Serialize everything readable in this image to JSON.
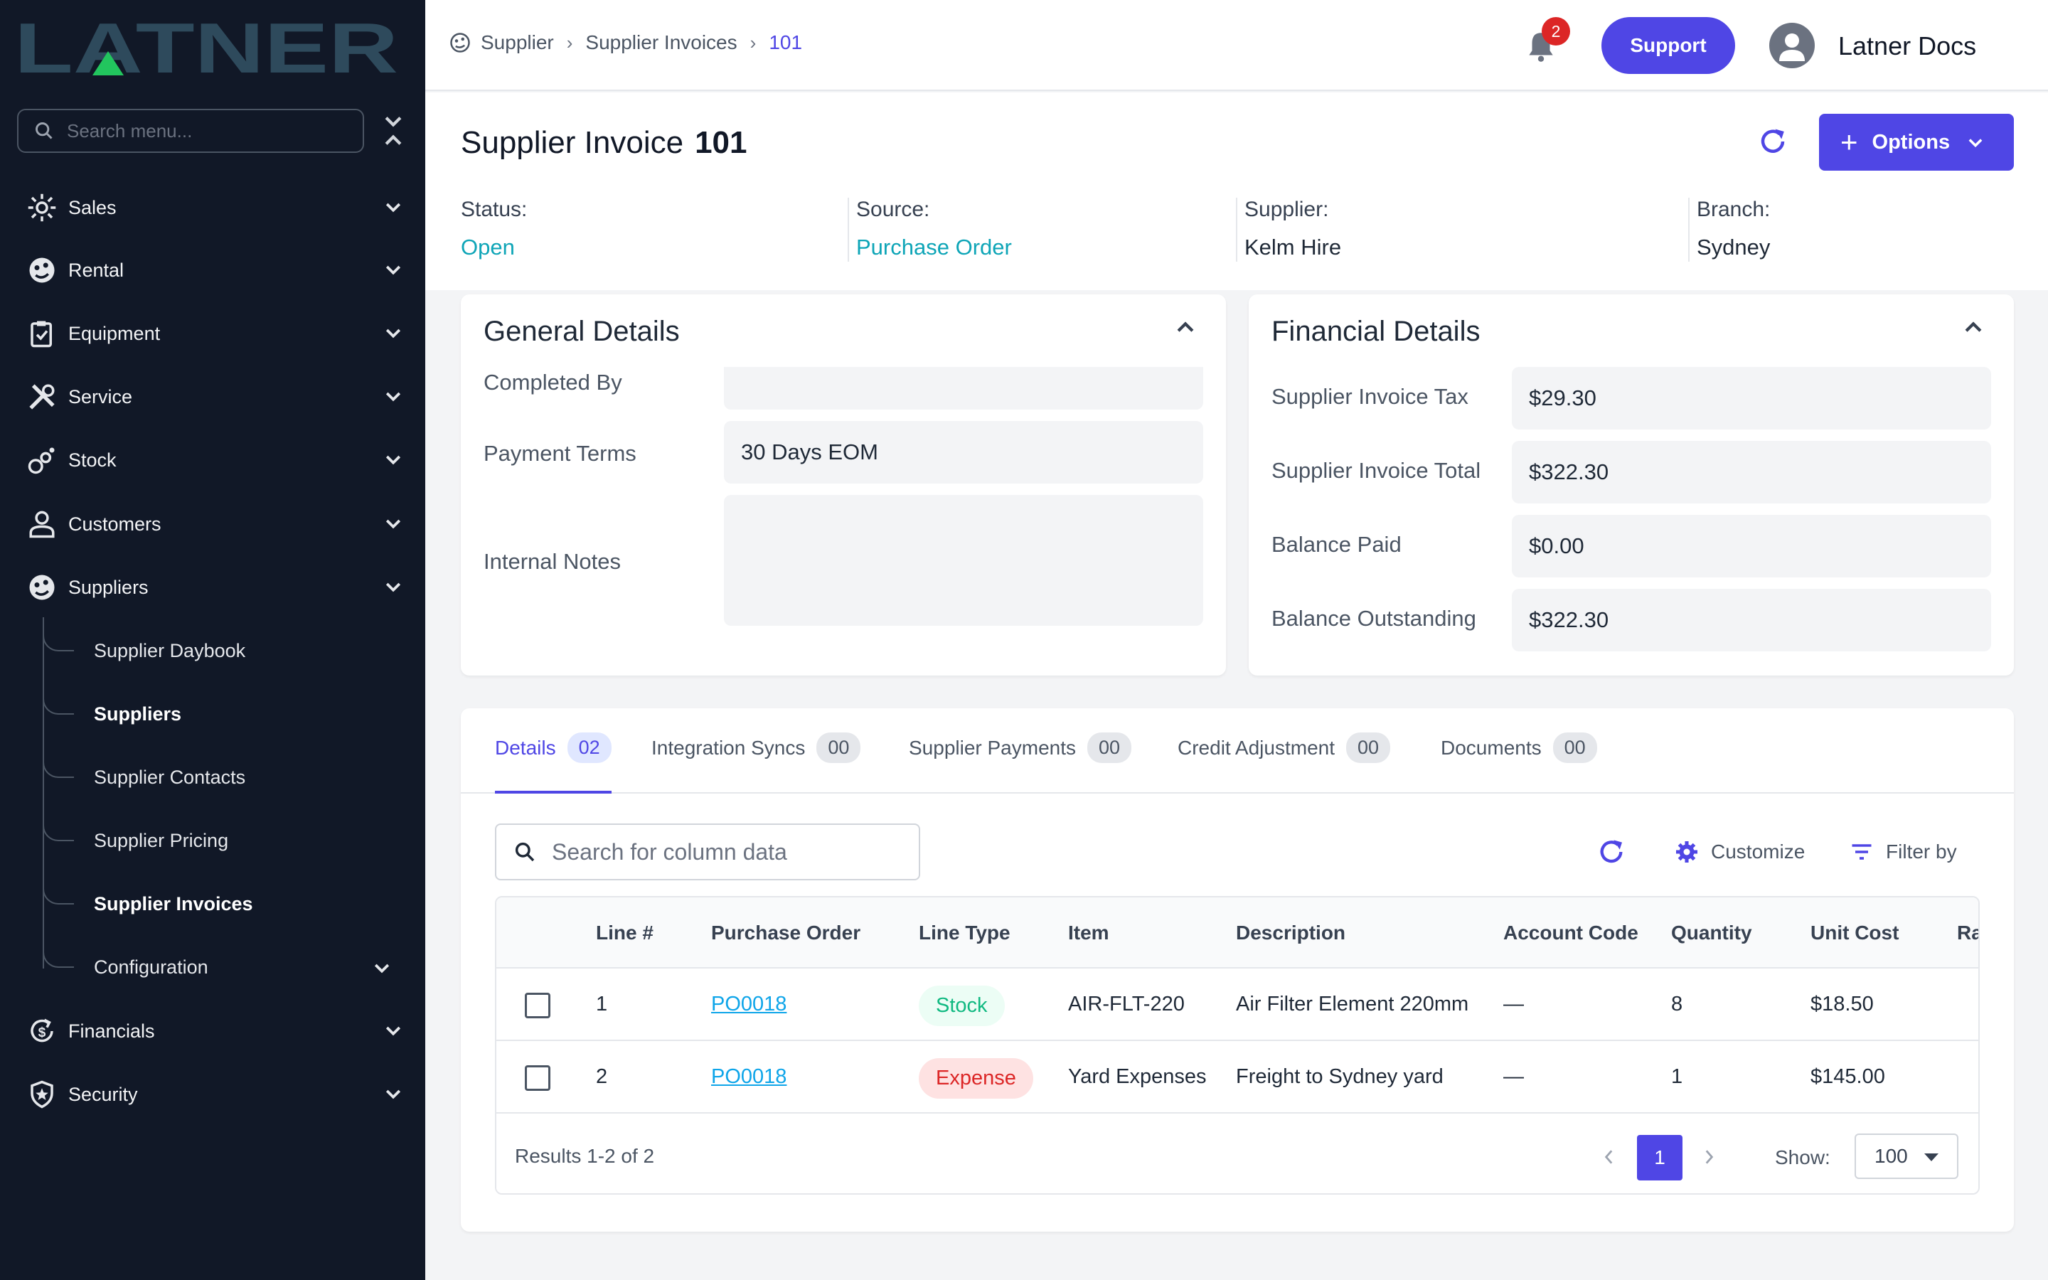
{
  "brand": {
    "logo_text": "LATNER",
    "accent": "#4f46e5",
    "logo_color": "#2e4a5c",
    "logo_accent": "#22c55e"
  },
  "sidebar": {
    "search_placeholder": "Search menu...",
    "items": [
      {
        "label": "Sales",
        "icon": "sales-icon"
      },
      {
        "label": "Rental",
        "icon": "rental-icon"
      },
      {
        "label": "Equipment",
        "icon": "equipment-icon"
      },
      {
        "label": "Service",
        "icon": "service-icon"
      },
      {
        "label": "Stock",
        "icon": "stock-icon"
      },
      {
        "label": "Customers",
        "icon": "customers-icon"
      },
      {
        "label": "Suppliers",
        "icon": "suppliers-icon"
      },
      {
        "label": "Financials",
        "icon": "financials-icon"
      },
      {
        "label": "Security",
        "icon": "security-icon"
      }
    ],
    "supplier_sub": [
      {
        "label": "Supplier Daybook"
      },
      {
        "label": "Suppliers"
      },
      {
        "label": "Supplier Contacts"
      },
      {
        "label": "Supplier Pricing"
      },
      {
        "label": "Supplier Invoices"
      },
      {
        "label": "Configuration"
      }
    ]
  },
  "topbar": {
    "breadcrumb": [
      "Supplier",
      "Supplier Invoices",
      "101"
    ],
    "notification_count": "2",
    "support_label": "Support",
    "user_name": "Latner Docs"
  },
  "header": {
    "title": "Supplier Invoice",
    "number": "101",
    "options_label": "Options",
    "meta": [
      {
        "label": "Status:",
        "value": "Open"
      },
      {
        "label": "Source:",
        "value": "Purchase Order"
      },
      {
        "label": "Supplier:",
        "value": "Kelm Hire"
      },
      {
        "label": "Branch:",
        "value": "Sydney"
      }
    ]
  },
  "general": {
    "title": "General Details",
    "completed_by_label": "Completed By",
    "completed_by_value": "",
    "payment_terms_label": "Payment Terms",
    "payment_terms_value": "30 Days EOM",
    "internal_notes_label": "Internal Notes",
    "internal_notes_value": ""
  },
  "financial": {
    "title": "Financial Details",
    "rows": [
      {
        "label": "Supplier Invoice Tax",
        "value": "$29.30"
      },
      {
        "label": "Supplier Invoice Total",
        "value": "$322.30"
      },
      {
        "label": "Balance Paid",
        "value": "$0.00"
      },
      {
        "label": "Balance Outstanding",
        "value": "$322.30"
      }
    ]
  },
  "tabs": [
    {
      "label": "Details",
      "count": "02"
    },
    {
      "label": "Integration Syncs",
      "count": "00"
    },
    {
      "label": "Supplier Payments",
      "count": "00"
    },
    {
      "label": "Credit Adjustment",
      "count": "00"
    },
    {
      "label": "Documents",
      "count": "00"
    }
  ],
  "table": {
    "search_placeholder": "Search for column data",
    "customize_label": "Customize",
    "filter_label": "Filter by",
    "columns": [
      "Line #",
      "Purchase Order",
      "Line Type",
      "Item",
      "Description",
      "Account Code",
      "Quantity",
      "Unit Cost",
      "Ra"
    ],
    "rows": [
      {
        "line": "1",
        "po": "PO0018",
        "type": "Stock",
        "item": "AIR-FLT-220",
        "description": "Air Filter Element 220mm",
        "account": "—",
        "qty": "8",
        "unit_cost": "$18.50"
      },
      {
        "line": "2",
        "po": "PO0018",
        "type": "Expense",
        "item": "Yard Expenses",
        "description": "Freight to Sydney yard",
        "account": "—",
        "qty": "1",
        "unit_cost": "$145.00"
      }
    ],
    "results_text": "Results 1-2 of 2",
    "current_page": "1",
    "show_label": "Show:",
    "page_size": "100"
  }
}
